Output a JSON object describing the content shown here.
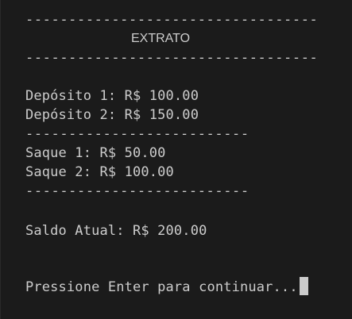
{
  "terminal": {
    "separator_long": "----------------------------------",
    "title": "EXTRATO",
    "separator_short": "--------------------------",
    "deposits": [
      "Depósito 1: R$ 100.00",
      "Depósito 2: R$ 150.00"
    ],
    "withdrawals": [
      "Saque 1: R$ 50.00",
      "Saque 2: R$ 100.00"
    ],
    "balance": "Saldo Atual: R$ 200.00",
    "prompt": "Pressione Enter para continuar..."
  },
  "colors": {
    "background": "#1b1b1b",
    "text": "#cccccc",
    "cursor": "#cccccc"
  }
}
